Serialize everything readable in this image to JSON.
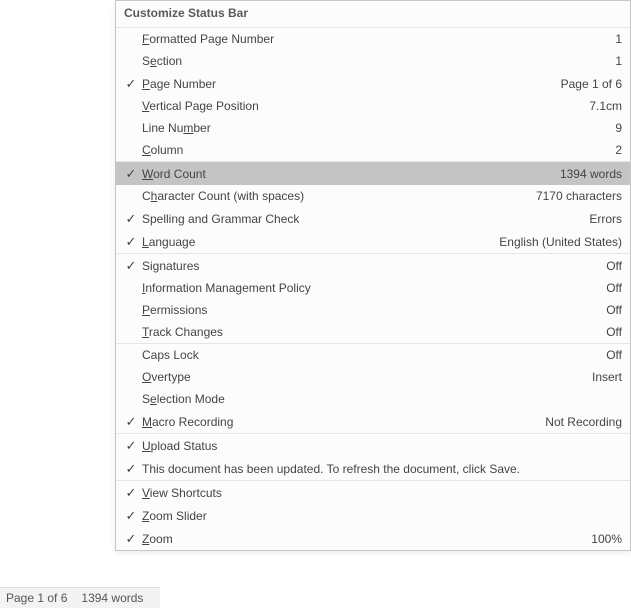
{
  "menu": {
    "title": "Customize Status Bar",
    "items": [
      {
        "label": "Formatted Page Number",
        "u": 0,
        "checked": false,
        "value": "1"
      },
      {
        "label": "Section",
        "u": 1,
        "checked": false,
        "value": "1"
      },
      {
        "label": "Page Number",
        "u": 0,
        "checked": true,
        "value": "Page 1 of 6"
      },
      {
        "label": "Vertical Page Position",
        "u": 0,
        "checked": false,
        "value": "7.1cm"
      },
      {
        "label": "Line Number",
        "u": 7,
        "checked": false,
        "value": "9"
      },
      {
        "label": "Column",
        "u": 0,
        "checked": false,
        "value": "2"
      },
      {
        "sep": true
      },
      {
        "label": "Word Count",
        "u": 0,
        "checked": true,
        "value": "1394 words",
        "selected": true
      },
      {
        "label": "Character Count (with spaces)",
        "u": 1,
        "checked": false,
        "value": "7170 characters"
      },
      {
        "label": "Spelling and Grammar Check",
        "u": -1,
        "checked": true,
        "value": "Errors"
      },
      {
        "label": "Language",
        "u": 0,
        "checked": true,
        "value": "English (United States)"
      },
      {
        "sep": true
      },
      {
        "label": "Signatures",
        "u": -1,
        "checked": true,
        "value": "Off"
      },
      {
        "label": "Information Management Policy",
        "u": 0,
        "checked": false,
        "value": "Off"
      },
      {
        "label": "Permissions",
        "u": 0,
        "checked": false,
        "value": "Off"
      },
      {
        "label": "Track Changes",
        "u": 0,
        "checked": false,
        "value": "Off"
      },
      {
        "sep": true
      },
      {
        "label": "Caps Lock",
        "u": -1,
        "checked": false,
        "value": "Off"
      },
      {
        "label": "Overtype",
        "u": 0,
        "checked": false,
        "value": "Insert"
      },
      {
        "label": "Selection Mode",
        "u": 1,
        "checked": false,
        "value": ""
      },
      {
        "label": "Macro Recording",
        "u": 0,
        "checked": true,
        "value": "Not Recording"
      },
      {
        "sep": true
      },
      {
        "label": "Upload Status",
        "u": 0,
        "checked": true,
        "value": ""
      },
      {
        "label": "This document has been updated. To refresh the document, click Save.",
        "u": -1,
        "checked": true,
        "value": ""
      },
      {
        "sep": true
      },
      {
        "label": "View Shortcuts",
        "u": 0,
        "checked": true,
        "value": ""
      },
      {
        "label": "Zoom Slider",
        "u": 0,
        "checked": true,
        "value": ""
      },
      {
        "label": "Zoom",
        "u": 0,
        "checked": true,
        "value": "100%"
      }
    ]
  },
  "status_bar": {
    "page": "Page 1 of 6",
    "words": "1394 words"
  }
}
